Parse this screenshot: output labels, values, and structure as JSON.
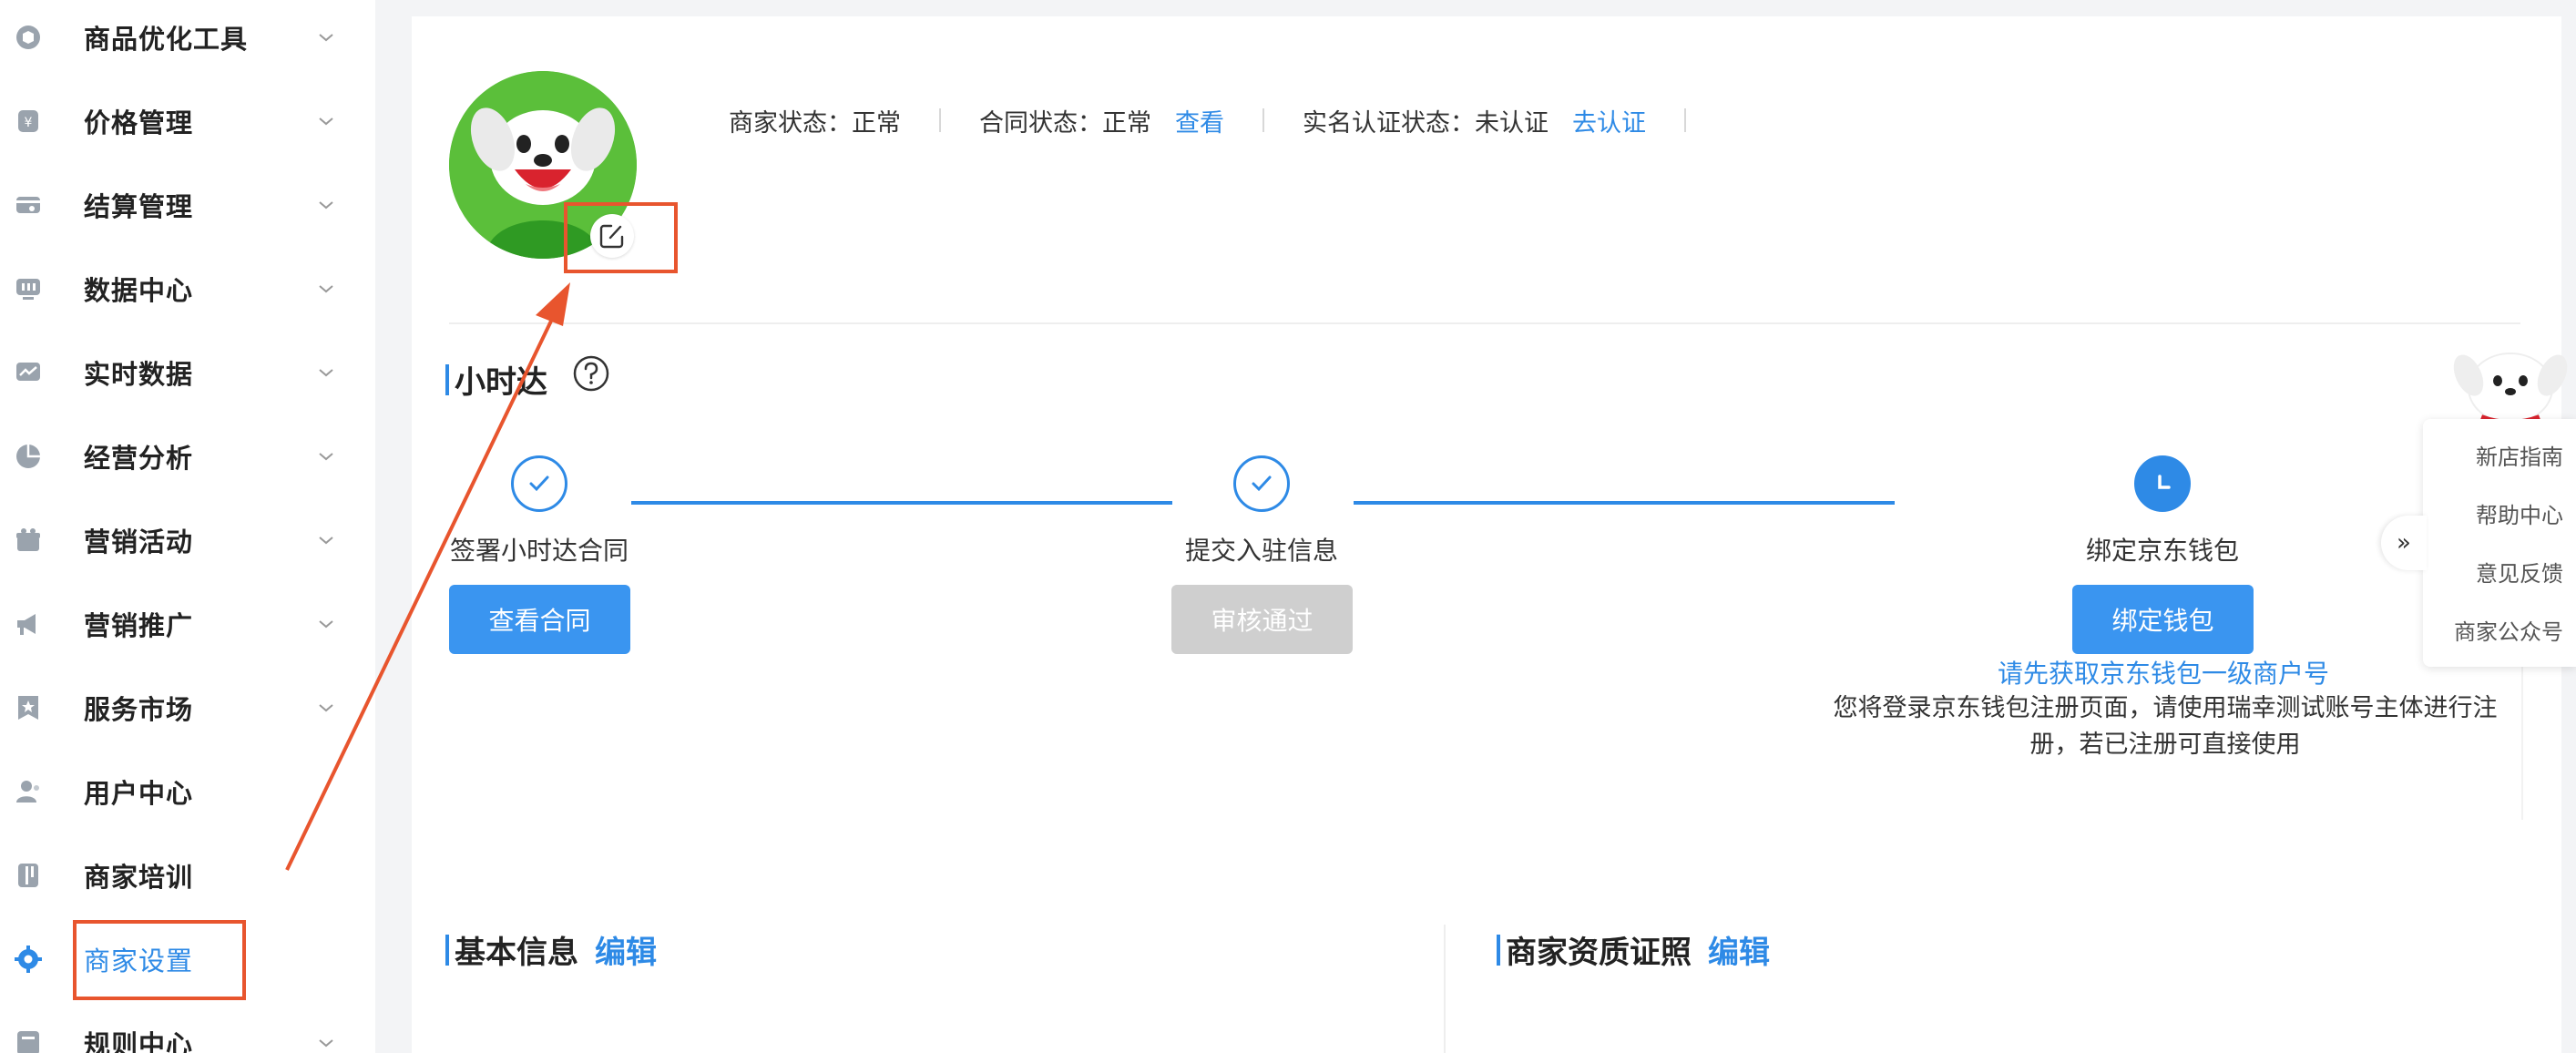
{
  "sidebar": {
    "items": [
      {
        "label": "商品优化工具",
        "icon": "cube-icon"
      },
      {
        "label": "价格管理",
        "icon": "yen-icon"
      },
      {
        "label": "结算管理",
        "icon": "wallet-icon"
      },
      {
        "label": "数据中心",
        "icon": "monitor-icon"
      },
      {
        "label": "实时数据",
        "icon": "trend-icon"
      },
      {
        "label": "经营分析",
        "icon": "pie-icon"
      },
      {
        "label": "营销活动",
        "icon": "gift-icon"
      },
      {
        "label": "营销推广",
        "icon": "megaphone-icon"
      },
      {
        "label": "服务市场",
        "icon": "star-badge-icon"
      },
      {
        "label": "用户中心",
        "icon": "user-icon"
      },
      {
        "label": "商家培训",
        "icon": "book-icon"
      },
      {
        "label": "商家设置",
        "icon": "gear-icon"
      },
      {
        "label": "规则中心",
        "icon": "rules-icon"
      }
    ]
  },
  "status": {
    "merchant_label": "商家状态：",
    "merchant_value": "正常",
    "contract_label": "合同状态：",
    "contract_value": "正常",
    "contract_link": "查看",
    "realname_label": "实名认证状态：",
    "realname_value": "未认证",
    "realname_link": "去认证"
  },
  "hourly": {
    "title": "小时达",
    "steps": [
      {
        "label": "签署小时达合同",
        "button": "查看合同",
        "state": "done"
      },
      {
        "label": "提交入驻信息",
        "button": "审核通过",
        "state": "done"
      },
      {
        "label": "绑定京东钱包",
        "button": "绑定钱包",
        "state": "current"
      }
    ],
    "wallet_link": "请先获取京东钱包一级商户号",
    "wallet_note": "您将登录京东钱包注册页面，请使用瑞幸测试账号主体进行注册，若已注册可直接使用"
  },
  "basic_info": {
    "title": "基本信息",
    "edit": "编辑"
  },
  "qualification": {
    "title": "商家资质证照",
    "edit": "编辑"
  },
  "float_panel": {
    "items": [
      "新店指南",
      "帮助中心",
      "意见反馈",
      "商家公众号"
    ],
    "collapse": "»"
  },
  "colors": {
    "accent": "#2e8ae6",
    "annotation": "#e8552e",
    "avatar_bg": "#5bbf3a"
  }
}
